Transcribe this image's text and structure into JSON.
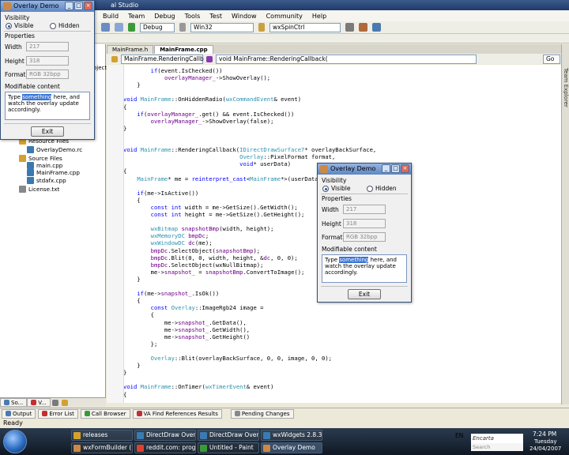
{
  "vs": {
    "title_fragment": "al Studio",
    "menu": [
      "Build",
      "Team",
      "Debug",
      "Tools",
      "Test",
      "Window",
      "Community",
      "Help"
    ],
    "toolbar": {
      "config": "Debug",
      "platform": "Win32",
      "find_target": "wxSpinCtrl"
    },
    "tabs": [
      "MainFrame.h",
      "MainFrame.cpp"
    ],
    "nav_scope": "MainFrame.RenderingCallb",
    "nav_member": "void MainFrame::RenderingCallback(",
    "right_strip": "Team Explorer",
    "go": "Go",
    "status": "Ready"
  },
  "solution": {
    "header_fragment": "oject",
    "items": [
      {
        "label": "Resource Files",
        "indent": 1
      },
      {
        "label": "OverlayDemo.rc",
        "indent": 2
      },
      {
        "label": "Source Files",
        "indent": 1
      },
      {
        "label": "main.cpp",
        "indent": 2
      },
      {
        "label": "MainFrame.cpp",
        "indent": 2
      },
      {
        "label": "stdafx.cpp",
        "indent": 2
      },
      {
        "label": "License.txt",
        "indent": 1
      }
    ],
    "tabs": [
      "So...",
      "V..."
    ]
  },
  "output_tabs": [
    "Output",
    "Error List",
    "Call Browser",
    "VA Find References Results",
    "Pending Changes"
  ],
  "code": [
    "        if(event.IsChecked())",
    "            overlayManager_->ShowOverlay();",
    "    }",
    "",
    "void MainFrame::OnHiddenRadio(wxCommandEvent& event)",
    "{",
    "    if(overlayManager_.get() && event.IsChecked())",
    "        overlayManager_->ShowOverlay(false);",
    "}",
    "",
    "",
    "void MainFrame::RenderingCallback(IDirectDrawSurface7* overlayBackSurface,",
    "                                  Overlay::PixelFormat format,",
    "                                  void* userData)",
    "{",
    "    MainFrame* me = reinterpret_cast<MainFrame*>(userData);",
    "",
    "    if(me->IsActive())",
    "    {",
    "        const int width = me->GetSize().GetWidth();",
    "        const int height = me->GetSize().GetHeight();",
    "",
    "        wxBitmap snapshotBmp(width, height);",
    "        wxMemoryDC bmpDc;",
    "        wxWindowDC dc(me);",
    "        bmpDc.SelectObject(snapshotBmp);",
    "        bmpDc.Blit(0, 0, width, height, &dc, 0, 0);",
    "        bmpDc.SelectObject(wxNullBitmap);",
    "        me->snapshot_ = snapshotBmp.ConvertToImage();",
    "    }",
    "",
    "    if(me->snapshot_.IsOk())",
    "    {",
    "        const Overlay::ImageRgb24 image =",
    "        {",
    "            me->snapshot_.GetData(),",
    "            me->snapshot_.GetWidth(),",
    "            me->snapshot_.GetHeight()",
    "        };",
    "",
    "        Overlay::Blit(overlayBackSurface, 0, 0, image, 0, 0);",
    "    }",
    "}",
    "",
    "void MainFrame::OnTimer(wxTimerEvent& event)",
    "{"
  ],
  "dialog": {
    "title": "Overlay Demo",
    "visibility_label": "Visibility",
    "visible_label": "Visible",
    "hidden_label": "Hidden",
    "properties_label": "Properties",
    "width_label": "Width",
    "width_value": "217",
    "height_label": "Height",
    "height_value": "318",
    "format_label": "Format",
    "format_value": "RGB 32bpp",
    "modifiable_label": "Modifiable content",
    "text_before": "Type ",
    "text_highlight": "something",
    "text_after": " here, and watch the overlay update accordingly.",
    "exit_label": "Exit"
  },
  "taskbar": {
    "row1": [
      "releases",
      "DirectDraw Overla...",
      "DirectDraw Overl...",
      "wxWidgets 2.8.3:..."
    ],
    "row2": [
      "wxFormBuilder (B...",
      "reddit.com: progr...",
      "Untitled - Paint",
      "Overlay Demo"
    ],
    "lang": "EN",
    "search_brand": "Encarta",
    "search_placeholder": "Search",
    "time": "7:24 PM",
    "day": "Tuesday",
    "date": "24/04/2007"
  },
  "colors": {
    "keyword": "#0000ff",
    "type": "#2b91af",
    "member": "#6f008a",
    "highlight": "#3874d6"
  }
}
